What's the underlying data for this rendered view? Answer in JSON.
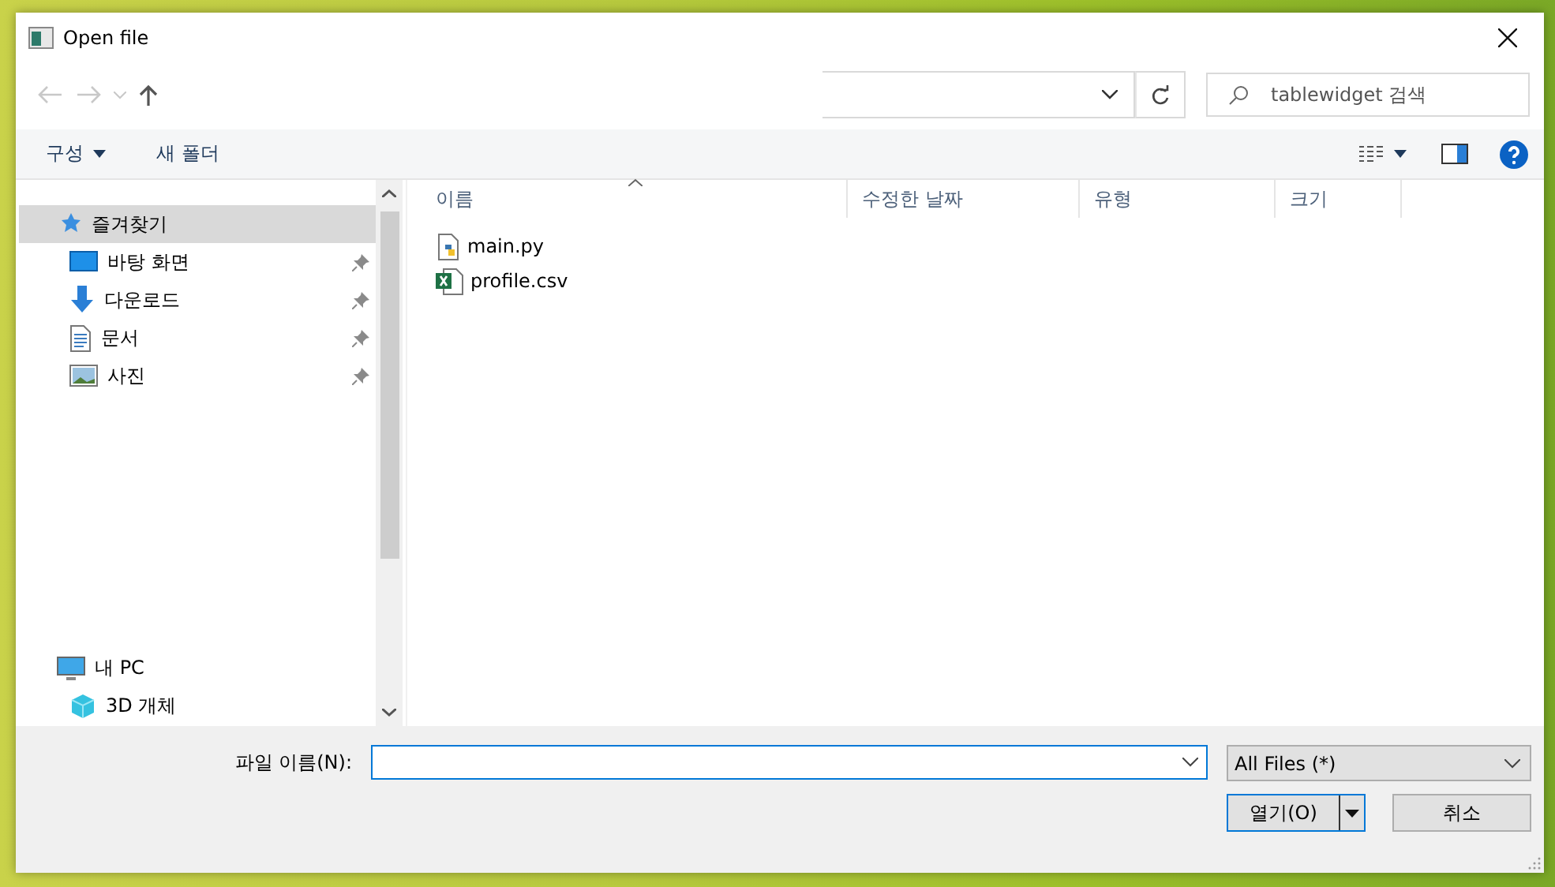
{
  "window": {
    "title": "Open file"
  },
  "search": {
    "placeholder": "tablewidget 검색"
  },
  "toolbar": {
    "organize": "구성",
    "new_folder": "새 폴더"
  },
  "sidebar": {
    "groups": [
      {
        "label": "즐겨찾기",
        "kind": "star",
        "selected": true,
        "children": [
          {
            "label": "바탕 화면",
            "kind": "desktop",
            "pinned": true,
            "selected": false
          },
          {
            "label": "다운로드",
            "kind": "download",
            "pinned": true,
            "selected": false
          },
          {
            "label": "문서",
            "kind": "document",
            "pinned": true,
            "selected": false
          },
          {
            "label": "사진",
            "kind": "picture",
            "pinned": true,
            "selected": false
          }
        ]
      },
      {
        "label": "내 PC",
        "kind": "pc",
        "selected": false,
        "children": [
          {
            "label": "3D 개체",
            "kind": "cube",
            "pinned": false,
            "selected": false
          }
        ]
      }
    ]
  },
  "columns": [
    {
      "label": "이름",
      "sorted": true
    },
    {
      "label": "수정한 날짜",
      "sorted": false
    },
    {
      "label": "유형",
      "sorted": false
    },
    {
      "label": "크기",
      "sorted": false
    }
  ],
  "files": [
    {
      "name": "main.py",
      "kind": "python",
      "selected": false
    },
    {
      "name": "profile.csv",
      "kind": "excel",
      "selected": false
    }
  ],
  "footer": {
    "filename_label": "파일 이름(N):",
    "filter": "All Files (*)",
    "open": "열기(O)",
    "cancel": "취소"
  }
}
